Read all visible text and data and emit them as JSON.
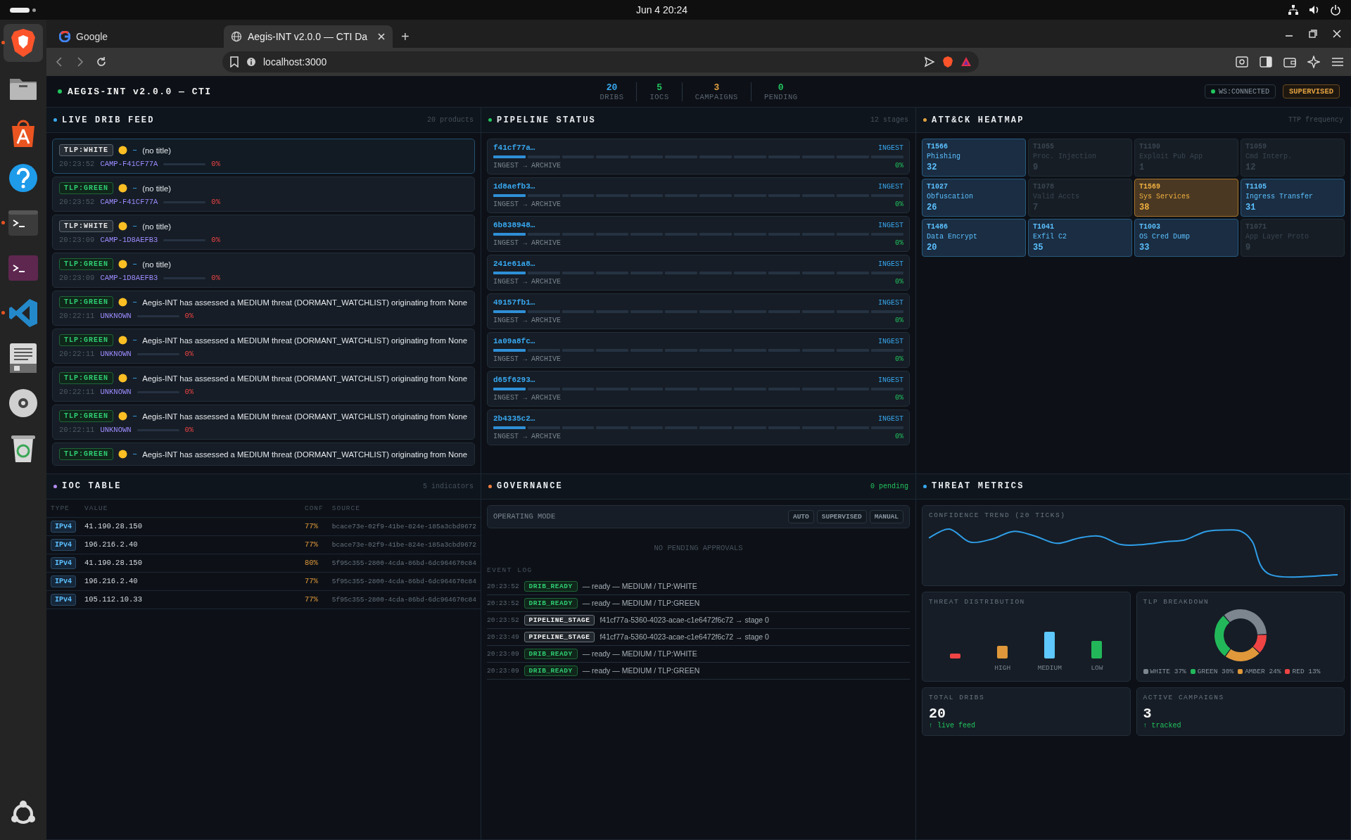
{
  "os_bar": {
    "clock": "Jun 4  20:24"
  },
  "dock": {
    "items": [
      {
        "kind": "lion",
        "running": true
      },
      {
        "kind": "folder",
        "running": false
      },
      {
        "kind": "store",
        "running": false
      },
      {
        "kind": "help",
        "running": false
      },
      {
        "kind": "terminal",
        "running": true
      },
      {
        "kind": "terminal-purple",
        "running": false
      },
      {
        "kind": "code",
        "running": true
      },
      {
        "kind": "notes",
        "running": false
      },
      {
        "kind": "disc",
        "running": false
      },
      {
        "kind": "trash",
        "running": false
      },
      {
        "kind": "ubuntu",
        "running": false
      }
    ]
  },
  "browser": {
    "tabs": [
      {
        "title": "Google",
        "kind": "google",
        "selected": false
      },
      {
        "title": "Aegis-INT v2.0.0 — CTI Da",
        "kind": "globe",
        "selected": true
      }
    ],
    "new_tab": "+",
    "address": "localhost:3000"
  },
  "app": {
    "title": "AEGIS-INT v2.0.0 — CTI",
    "stats": [
      {
        "value": "20",
        "label": "DRIBS",
        "color": "#38a8f0"
      },
      {
        "value": "5",
        "label": "IOCS",
        "color": "#22c55e"
      },
      {
        "value": "3",
        "label": "CAMPAIGNS",
        "color": "#e0a040"
      },
      {
        "value": "0",
        "label": "PENDING",
        "color": "#22c55e"
      }
    ],
    "connection": "WS:CONNECTED",
    "mode_badge": "SUPERVISED"
  },
  "feed": {
    "title": "LIVE DRIB FEED",
    "color": "#38a8f0",
    "meta": "20 products",
    "items": [
      {
        "selected": true,
        "tlp": "TLP:WHITE",
        "kind": "white",
        "dash": "–",
        "text": "(no title)",
        "time": "20:23:52",
        "campaign": "CAMP-F41CF77A",
        "pct": "0%"
      },
      {
        "selected": false,
        "tlp": "TLP:GREEN",
        "kind": "green",
        "dash": "–",
        "text": "(no title)",
        "time": "20:23:52",
        "campaign": "CAMP-F41CF77A",
        "pct": "0%"
      },
      {
        "selected": false,
        "tlp": "TLP:WHITE",
        "kind": "white",
        "dash": "–",
        "text": "(no title)",
        "time": "20:23:09",
        "campaign": "CAMP-1D8AEFB3",
        "pct": "0%"
      },
      {
        "selected": false,
        "tlp": "TLP:GREEN",
        "kind": "green",
        "dash": "–",
        "text": "(no title)",
        "time": "20:23:09",
        "campaign": "CAMP-1D8AEFB3",
        "pct": "0%"
      },
      {
        "selected": false,
        "tlp": "TLP:GREEN",
        "kind": "green",
        "dash": "–",
        "text": "Aegis-INT has assessed a MEDIUM threat (DORMANT_WATCHLIST) originating from None",
        "time": "20:22:11",
        "campaign": "UNKNOWN",
        "pct": "0%"
      },
      {
        "selected": false,
        "tlp": "TLP:GREEN",
        "kind": "green",
        "dash": "–",
        "text": "Aegis-INT has assessed a MEDIUM threat (DORMANT_WATCHLIST) originating from None",
        "time": "20:22:11",
        "campaign": "UNKNOWN",
        "pct": "0%"
      },
      {
        "selected": false,
        "tlp": "TLP:GREEN",
        "kind": "green",
        "dash": "–",
        "text": "Aegis-INT has assessed a MEDIUM threat (DORMANT_WATCHLIST) originating from None",
        "time": "20:22:11",
        "campaign": "UNKNOWN",
        "pct": "0%"
      },
      {
        "selected": false,
        "tlp": "TLP:GREEN",
        "kind": "green",
        "dash": "–",
        "text": "Aegis-INT has assessed a MEDIUM threat (DORMANT_WATCHLIST) originating from None",
        "time": "20:22:11",
        "campaign": "UNKNOWN",
        "pct": "0%"
      },
      {
        "selected": false,
        "tlp": "TLP:GREEN",
        "kind": "green",
        "dash": "–",
        "text": "Aegis-INT has assessed a MEDIUM threat (DORMANT_WATCHLIST) originating from None"
      }
    ]
  },
  "pipeline": {
    "title": "PIPELINE STATUS",
    "color": "#22c55e",
    "meta": "12 stages",
    "items": [
      {
        "id": "f41cf77a…",
        "stage": "INGEST",
        "route": "INGEST → ARCHIVE",
        "pct": "0%",
        "level": 0.0833
      },
      {
        "id": "1d8aefb3…",
        "stage": "INGEST",
        "route": "INGEST → ARCHIVE",
        "pct": "0%",
        "level": 0.0833
      },
      {
        "id": "6b838948…",
        "stage": "INGEST",
        "route": "INGEST → ARCHIVE",
        "pct": "0%",
        "level": 0.0833
      },
      {
        "id": "241e61a8…",
        "stage": "INGEST",
        "route": "INGEST → ARCHIVE",
        "pct": "0%",
        "level": 0.0833
      },
      {
        "id": "49157fb1…",
        "stage": "INGEST",
        "route": "INGEST → ARCHIVE",
        "pct": "0%",
        "level": 0.0833
      },
      {
        "id": "1a09a8fc…",
        "stage": "INGEST",
        "route": "INGEST → ARCHIVE",
        "pct": "0%",
        "level": 0.0833
      },
      {
        "id": "d65f6293…",
        "stage": "INGEST",
        "route": "INGEST → ARCHIVE",
        "pct": "0%",
        "level": 0.0833
      },
      {
        "id": "2b4335c2…",
        "stage": "INGEST",
        "route": "INGEST → ARCHIVE",
        "pct": "0%",
        "level": 0.0833
      }
    ]
  },
  "heatmap": {
    "title": "ATT&CK HEATMAP",
    "color": "#e0a040",
    "meta": "TTP frequency",
    "cells": [
      {
        "id": "T1566",
        "name": "Phishing",
        "count": "32",
        "kind": "mid"
      },
      {
        "id": "T1055",
        "name": "Proc. Injection",
        "count": "9",
        "kind": "low"
      },
      {
        "id": "T1190",
        "name": "Exploit Pub App",
        "count": "1",
        "kind": "low"
      },
      {
        "id": "T1059",
        "name": "Cmd Interp.",
        "count": "12",
        "kind": "low"
      },
      {
        "id": "T1027",
        "name": "Obfuscation",
        "count": "26",
        "kind": "mid"
      },
      {
        "id": "T1078",
        "name": "Valid Accts",
        "count": "7",
        "kind": "low"
      },
      {
        "id": "T1569",
        "name": "Sys Services",
        "count": "38",
        "kind": "high"
      },
      {
        "id": "T1105",
        "name": "Ingress Transfer",
        "count": "31",
        "kind": "mid"
      },
      {
        "id": "T1486",
        "name": "Data Encrypt",
        "count": "20",
        "kind": "mid"
      },
      {
        "id": "T1041",
        "name": "Exfil C2",
        "count": "35",
        "kind": "mid"
      },
      {
        "id": "T1003",
        "name": "OS Cred Dump",
        "count": "33",
        "kind": "mid"
      },
      {
        "id": "T1071",
        "name": "App Layer Proto",
        "count": "9",
        "kind": "low"
      }
    ]
  },
  "ioc_table": {
    "title": "IOC TABLE",
    "color": "#b48cf0",
    "meta": "5 indicators",
    "columns": [
      "TYPE",
      "VALUE",
      "CONF",
      "SOURCE"
    ],
    "rows": [
      {
        "type": "IPv4",
        "value": "41.190.28.150",
        "conf": "77%",
        "source": "bcace73e-02f9-41be-824e-185a3cbd9672"
      },
      {
        "type": "IPv4",
        "value": "196.216.2.40",
        "conf": "77%",
        "source": "bcace73e-02f9-41be-824e-185a3cbd9672"
      },
      {
        "type": "IPv4",
        "value": "41.190.28.150",
        "conf": "80%",
        "source": "5f95c355-2800-4cda-86bd-6dc964670c84"
      },
      {
        "type": "IPv4",
        "value": "196.216.2.40",
        "conf": "77%",
        "source": "5f95c355-2800-4cda-86bd-6dc964670c84"
      },
      {
        "type": "IPv4",
        "value": "105.112.10.33",
        "conf": "77%",
        "source": "5f95c355-2800-4cda-86bd-6dc964670c84"
      }
    ]
  },
  "governance": {
    "title": "GOVERNANCE",
    "color": "#f08040",
    "meta": "0 pending",
    "mode_label": "OPERATING MODE",
    "modes": [
      "AUTO",
      "SUPERVISED",
      "MANUAL"
    ],
    "empty": "NO PENDING APPROVALS",
    "log_title": "EVENT LOG",
    "events": [
      {
        "time": "20:23:52",
        "tag": "DRIB_READY",
        "kind": "ready",
        "text": "— ready — MEDIUM / TLP:WHITE"
      },
      {
        "time": "20:23:52",
        "tag": "DRIB_READY",
        "kind": "ready",
        "text": "— ready — MEDIUM / TLP:GREEN"
      },
      {
        "time": "20:23:52",
        "tag": "PIPELINE_STAGE",
        "kind": "stage",
        "text": "f41cf77a-5360-4023-acae-c1e6472f6c72 → stage 0"
      },
      {
        "time": "20:23:49",
        "tag": "PIPELINE_STAGE",
        "kind": "stage",
        "text": "f41cf77a-5360-4023-acae-c1e6472f6c72 → stage 0"
      },
      {
        "time": "20:23:09",
        "tag": "DRIB_READY",
        "kind": "ready",
        "text": "— ready — MEDIUM / TLP:WHITE"
      },
      {
        "time": "20:23:09",
        "tag": "DRIB_READY",
        "kind": "ready",
        "text": "— ready — MEDIUM / TLP:GREEN"
      }
    ]
  },
  "metrics": {
    "title": "THREAT METRICS",
    "color": "#38a8f0",
    "trend_title": "CONFIDENCE TREND (20 TICKS)",
    "distribution": {
      "title": "THREAT DISTRIBUTION",
      "bars": [
        {
          "color": "#ef4444"
        },
        {
          "label": "HIGH",
          "color": "#e0983a"
        },
        {
          "label": "MEDIUM",
          "color": "#5ec8ff"
        },
        {
          "label": "LOW",
          "color": "#22b85a"
        }
      ]
    },
    "tlp": {
      "title": "TLP BREAKDOWN",
      "legend": [
        {
          "label": "WHITE",
          "pct": "37%",
          "color": "#7d858f"
        },
        {
          "label": "GREEN",
          "pct": "30%",
          "color": "#22b85a"
        },
        {
          "label": "AMBER",
          "pct": "24%",
          "color": "#e0983a"
        },
        {
          "label": "RED",
          "pct": "13%",
          "color": "#ef4444"
        }
      ]
    },
    "kpis": [
      {
        "label": "TOTAL DRIBS",
        "value": "20",
        "note": "↑ live feed"
      },
      {
        "label": "ACTIVE CAMPAIGNS",
        "value": "3",
        "note": "↑ tracked"
      }
    ]
  }
}
